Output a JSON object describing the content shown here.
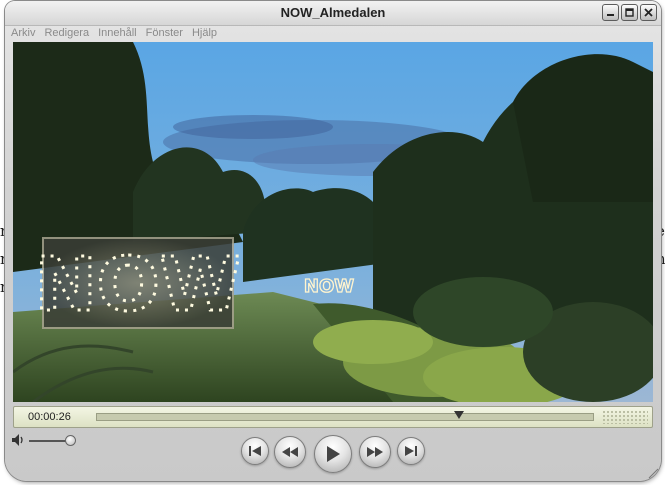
{
  "window": {
    "title": "NOW_Almedalen"
  },
  "menu": {
    "items": [
      "Arkiv",
      "Redigera",
      "Innehåll",
      "Fönster",
      "Hjälp"
    ]
  },
  "video": {
    "sign_text": "NOW",
    "small_sign_text": "NOW"
  },
  "playback": {
    "timecode": "00:00:26",
    "progress": 0.73
  },
  "volume": {
    "level": 0.9
  },
  "background_fragments": {
    "left": [
      "r",
      "n",
      "n"
    ],
    "right": [
      "e",
      "n"
    ]
  },
  "colors": {
    "control_bar": "#e8ebd2",
    "sky": "#6a9fd0"
  },
  "icons": [
    "minimize-icon",
    "maximize-icon",
    "close-icon",
    "speaker-icon",
    "skip-back-icon",
    "rewind-icon",
    "play-icon",
    "fast-forward-icon",
    "skip-forward-icon",
    "resize-grip-icon"
  ]
}
